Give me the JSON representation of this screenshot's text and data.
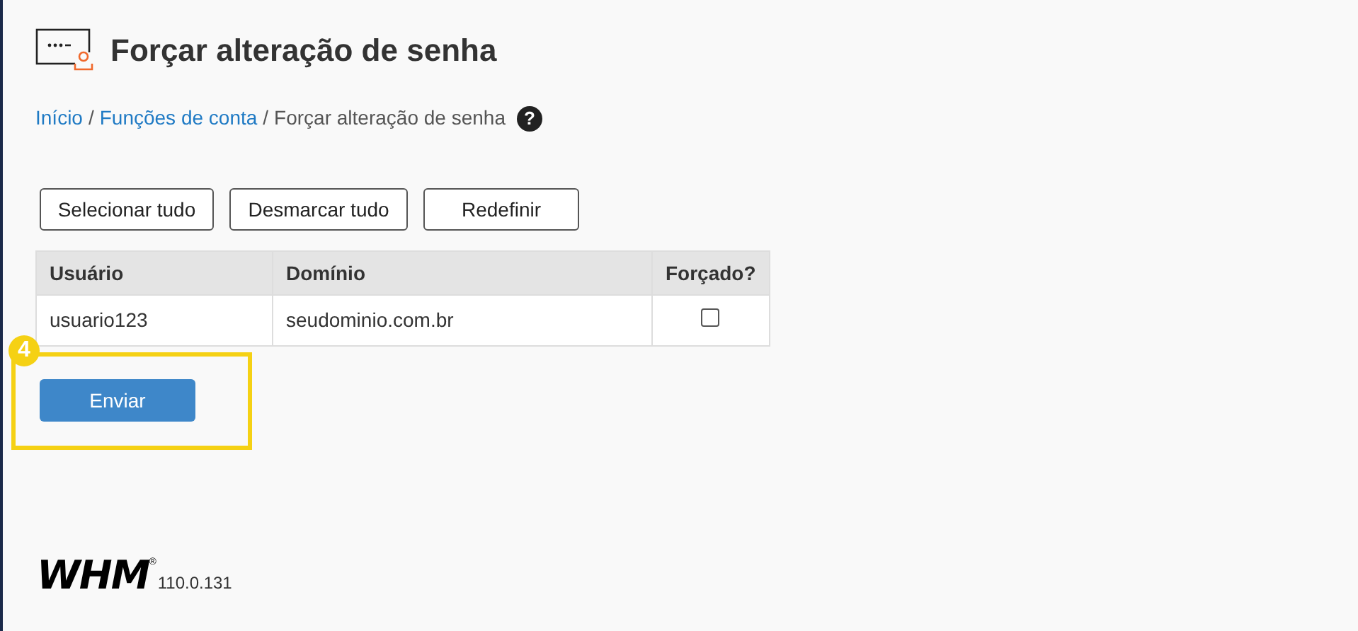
{
  "title": "Forçar alteração de senha",
  "breadcrumb": [
    {
      "label": "Início",
      "link": true,
      "separator": "/"
    },
    {
      "label": "Funções de conta",
      "link": true,
      "separator": "/"
    },
    {
      "label": "Forçar alteração de senha",
      "link": false
    }
  ],
  "help": "?",
  "toolbar_buttons": [
    "Selecionar tudo",
    "Desmarcar tudo",
    "Redefinir"
  ],
  "table": {
    "columns": [
      "Usuário",
      "Domínio",
      "Forçado?"
    ],
    "rows": [
      {
        "user": "usuario123",
        "domain": "seudominio.com.br",
        "checked": false
      }
    ]
  },
  "submit": "Enviar",
  "annotation": {
    "number": "4"
  },
  "footer": {
    "logo": "WHM",
    "trademark": "®",
    "version": "110.0.131"
  }
}
